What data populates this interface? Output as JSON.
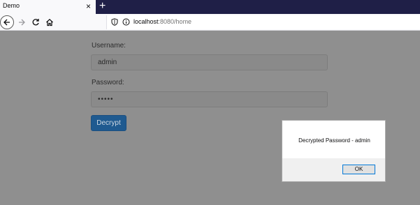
{
  "browser": {
    "tab_title": "Demo",
    "tab_close": "×",
    "new_tab": "+",
    "url_host": "localhost",
    "url_rest": ":8080/home"
  },
  "form": {
    "username_label": "Username:",
    "username_value": "admin",
    "password_label": "Password:",
    "password_value": "•••••",
    "decrypt_label": "Decrypt"
  },
  "dialog": {
    "message": "Decrypted Password - admin",
    "ok_label": "OK"
  }
}
